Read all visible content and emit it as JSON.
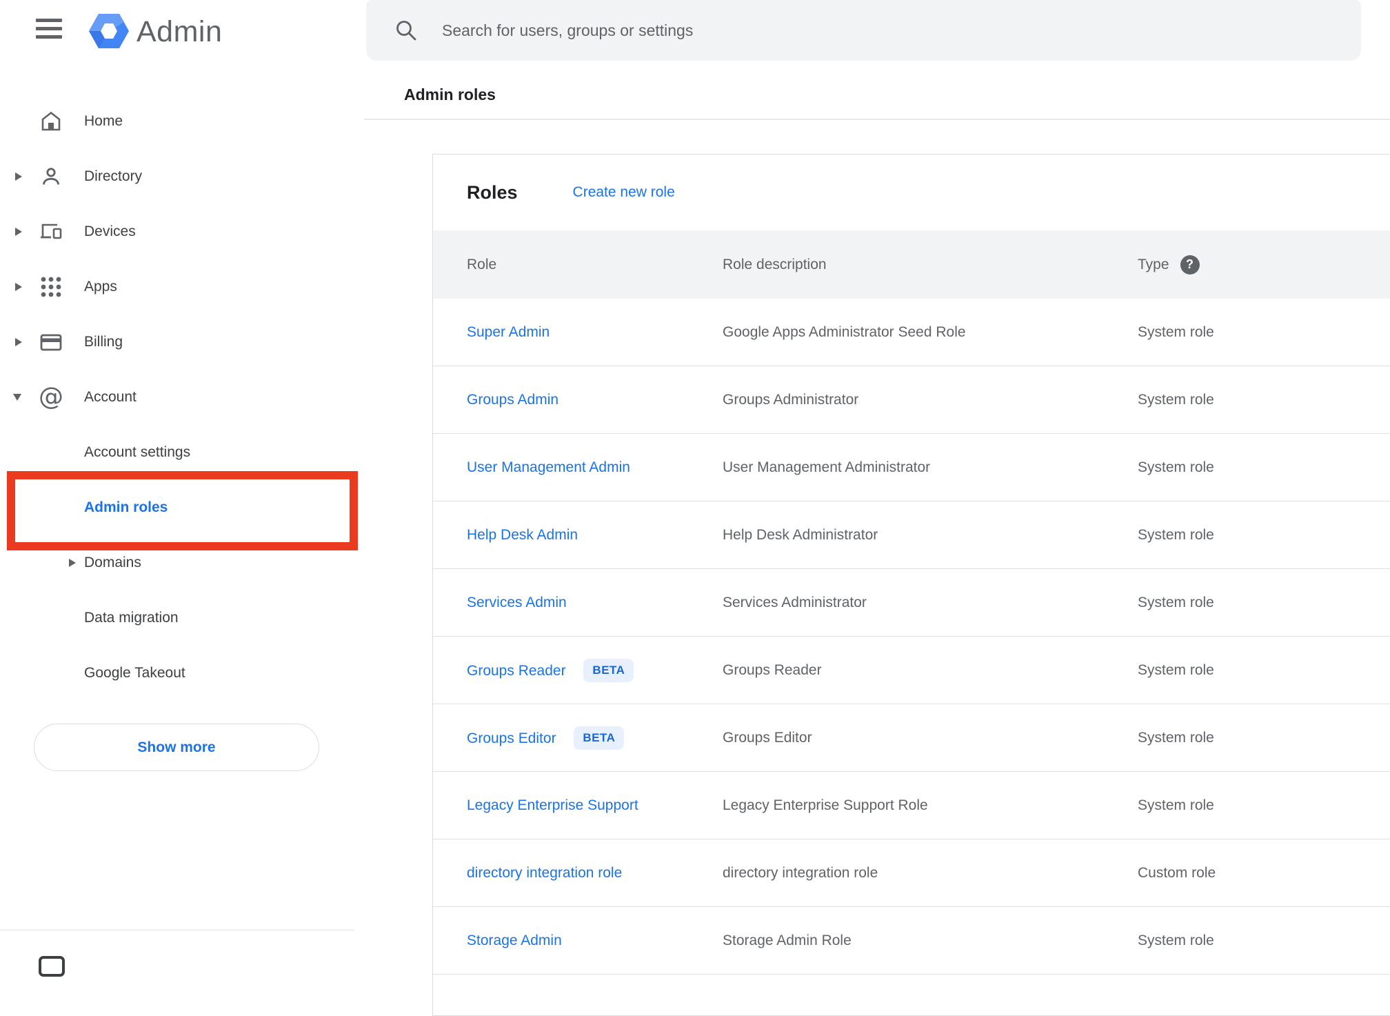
{
  "app": {
    "brand": "Admin"
  },
  "search": {
    "placeholder": "Search for users, groups or settings"
  },
  "breadcrumb": {
    "label": "Admin roles"
  },
  "sidebar": {
    "items": [
      {
        "label": "Home",
        "icon": "home-icon",
        "expandable": false
      },
      {
        "label": "Directory",
        "icon": "person-icon",
        "expandable": true
      },
      {
        "label": "Devices",
        "icon": "devices-icon",
        "expandable": true
      },
      {
        "label": "Apps",
        "icon": "apps-grid-icon",
        "expandable": true
      },
      {
        "label": "Billing",
        "icon": "credit-card-icon",
        "expandable": true
      },
      {
        "label": "Account",
        "icon": "at-sign-icon",
        "expandable": true,
        "expanded": true
      }
    ],
    "account_children": [
      {
        "label": "Account settings",
        "active": false
      },
      {
        "label": "Admin roles",
        "active": true
      },
      {
        "label": "Domains",
        "active": false,
        "expandable": true
      },
      {
        "label": "Data migration",
        "active": false
      },
      {
        "label": "Google Takeout",
        "active": false
      }
    ],
    "show_more_label": "Show more"
  },
  "main": {
    "title": "Roles",
    "create_new_role_label": "Create new role",
    "table": {
      "columns": {
        "role": "Role",
        "description": "Role description",
        "type": "Type"
      },
      "beta_label": "BETA",
      "help_glyph": "?",
      "rows": [
        {
          "role": "Super Admin",
          "description": "Google Apps Administrator Seed Role",
          "type": "System role",
          "beta": false
        },
        {
          "role": "Groups Admin",
          "description": "Groups Administrator",
          "type": "System role",
          "beta": false
        },
        {
          "role": "User Management Admin",
          "description": "User Management Administrator",
          "type": "System role",
          "beta": false
        },
        {
          "role": "Help Desk Admin",
          "description": "Help Desk Administrator",
          "type": "System role",
          "beta": false
        },
        {
          "role": "Services Admin",
          "description": "Services Administrator",
          "type": "System role",
          "beta": false
        },
        {
          "role": "Groups Reader",
          "description": "Groups Reader",
          "type": "System role",
          "beta": true
        },
        {
          "role": "Groups Editor",
          "description": "Groups Editor",
          "type": "System role",
          "beta": true
        },
        {
          "role": "Legacy Enterprise Support",
          "description": "Legacy Enterprise Support Role",
          "type": "System role",
          "beta": false
        },
        {
          "role": "directory integration role",
          "description": "directory integration role",
          "type": "Custom role",
          "beta": false
        },
        {
          "role": "Storage Admin",
          "description": "Storage Admin Role",
          "type": "System role",
          "beta": false
        }
      ]
    }
  },
  "colors": {
    "accent_blue": "#1a73e8",
    "active_item_bg": "#e8f0fe",
    "annotation_red": "#ea3b21",
    "table_header_bg": "#f1f3f4",
    "badge_text_blue": "#1967d2",
    "icon_gray": "#5f6368"
  }
}
